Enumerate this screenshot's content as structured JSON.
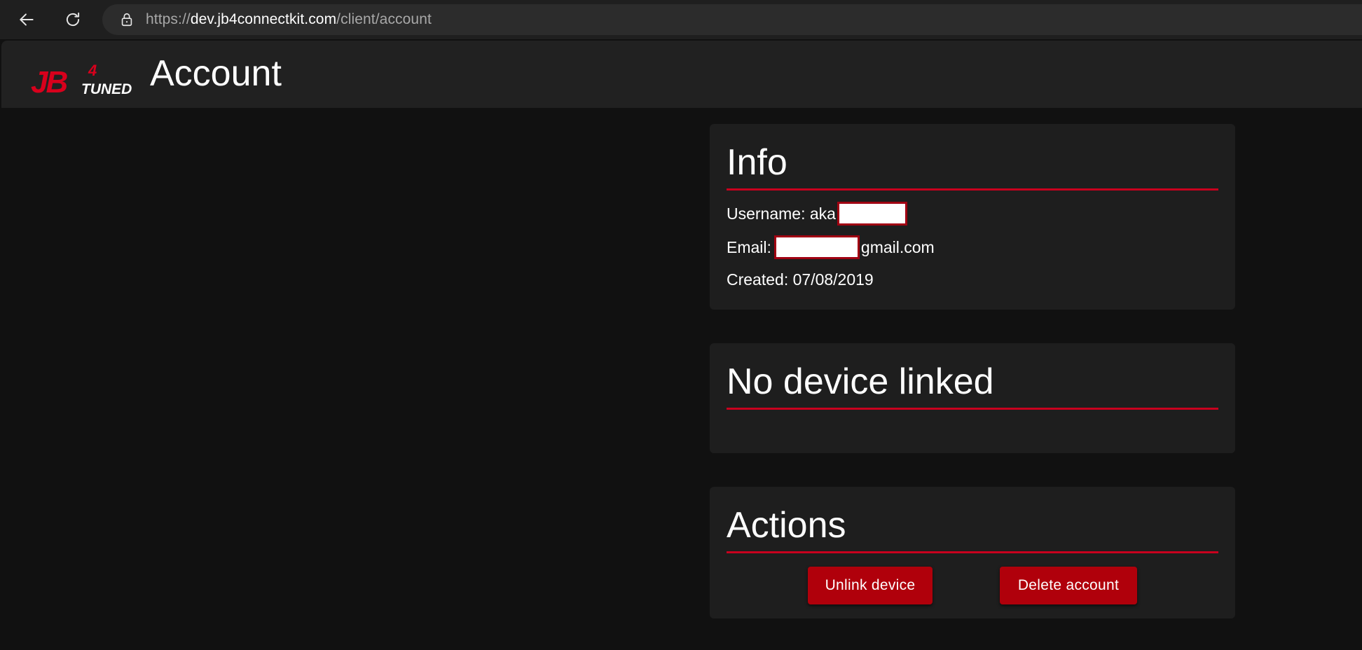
{
  "browser": {
    "url_scheme": "https://",
    "url_host": "dev.jb4connectkit.com",
    "url_path": "/client/account",
    "icons": {
      "back": "arrow-left-icon",
      "reload": "reload-icon",
      "secure": "lock-icon"
    }
  },
  "header": {
    "logo_main": "JB",
    "logo_super": "4",
    "logo_sub": "TUNED",
    "title": "Account",
    "accent_color": "#c8001e"
  },
  "info": {
    "title": "Info",
    "username_label": "Username: aka",
    "email_label": "Email:",
    "email_domain": "gmail.com",
    "created": "Created: 07/08/2019"
  },
  "device": {
    "title": "No device linked"
  },
  "actions": {
    "title": "Actions",
    "unlink_label": "Unlink device",
    "delete_label": "Delete account",
    "button_color": "#b0000b"
  }
}
